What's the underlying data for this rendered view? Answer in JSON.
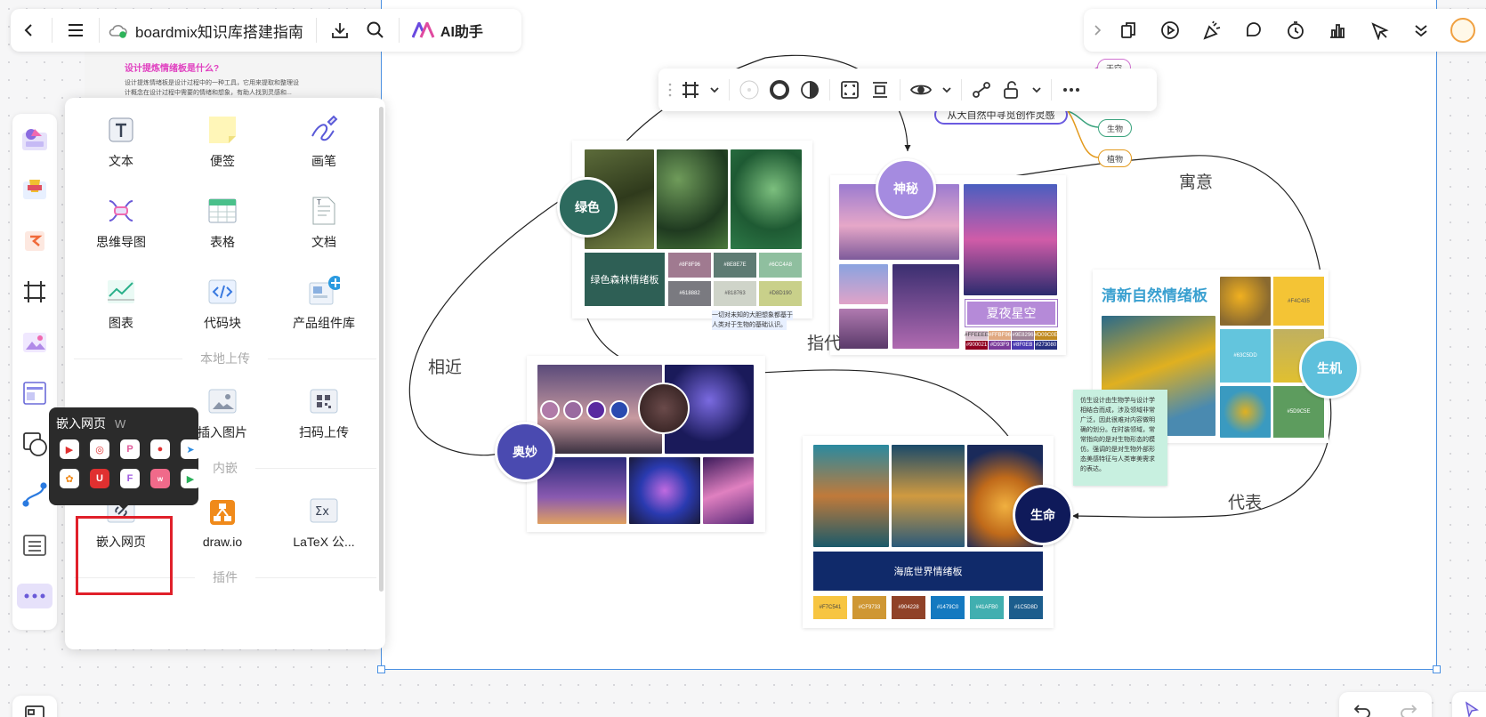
{
  "toolbar": {
    "title": "boardmix知识库搭建指南",
    "ai_label": "AI助手"
  },
  "bg_doc": {
    "heading": "设计提炼情绪板是什么?",
    "line1": "设计提炼情绪板是设计过程中的一种工具，它用来提取和整理设",
    "line2": "计概念在设计过程中需要的情绪和想象，有助人找到灵感和..."
  },
  "panel": {
    "tools": [
      {
        "label": "文本",
        "icon": "text-icon"
      },
      {
        "label": "便签",
        "icon": "sticky-note-icon"
      },
      {
        "label": "画笔",
        "icon": "pen-icon"
      },
      {
        "label": "思维导图",
        "icon": "mindmap-icon"
      },
      {
        "label": "表格",
        "icon": "table-icon"
      },
      {
        "label": "文档",
        "icon": "document-icon"
      },
      {
        "label": "图表",
        "icon": "chart-icon"
      },
      {
        "label": "代码块",
        "icon": "code-block-icon"
      },
      {
        "label": "产品组件库",
        "icon": "component-library-icon"
      }
    ],
    "section_local": "本地上传",
    "upload": [
      {
        "label": "插入图片",
        "icon": "image-icon"
      },
      {
        "label": "扫码上传",
        "icon": "qr-upload-icon"
      }
    ],
    "section_embed": "内嵌",
    "embed": [
      {
        "label": "嵌入网页",
        "icon": "embed-web-icon"
      },
      {
        "label": "draw.io",
        "icon": "drawio-icon"
      },
      {
        "label": "LaTeX 公...",
        "icon": "latex-icon"
      }
    ],
    "section_plugin": "插件"
  },
  "tooltip": {
    "title": "嵌入网页",
    "shortcut": "W"
  },
  "canvas": {
    "nodes": {
      "green": "绿色",
      "mystery": "神秘",
      "wonder": "奥妙",
      "life": "生命",
      "vitality": "生机"
    },
    "edges": {
      "similar": "相近",
      "refer": "指代",
      "meaning": "寓意",
      "represent": "代表"
    },
    "mindmap": {
      "root": "从大自然中寻觅创作灵感",
      "top": "天空",
      "bio": "生物",
      "plant": "植物"
    },
    "boards": {
      "forest": "绿色森林情绪板",
      "forest_note1": "一切对未知的大胆想象都基于",
      "forest_note2": "人类对于生物的基础认识。",
      "starry": "夏夜星空",
      "ocean": "海底世界情绪板",
      "fresh": "清新自然情绪板",
      "bio_note": "仿生设计由生物学与设计学相结合而成，涉及领域非常广泛，因此很难对内容做明确的划分。在时装领域，常常指向的是对生物形态的模仿。强调的是对生物外部形态美感特征与人类审美需求的表达。"
    },
    "swatches": {
      "forest": [
        "#8F8F96",
        "#8E8E7E",
        "#6CC4A8",
        "#618882",
        "#818763",
        "#D8D190"
      ],
      "starry": [
        "#FFEEEE",
        "#FFBF96",
        "#9E8296",
        "#D09C0E",
        "#900021",
        "#D93F9",
        "#8F0EB",
        "#273080"
      ],
      "ocean": [
        "#F7C541",
        "#CF9733",
        "#904228",
        "#1479C0",
        "#41AFB0",
        "#1C5D8D"
      ],
      "fresh": [
        "#F4C435",
        "#63C5DD",
        "#5D9C5E"
      ]
    }
  }
}
